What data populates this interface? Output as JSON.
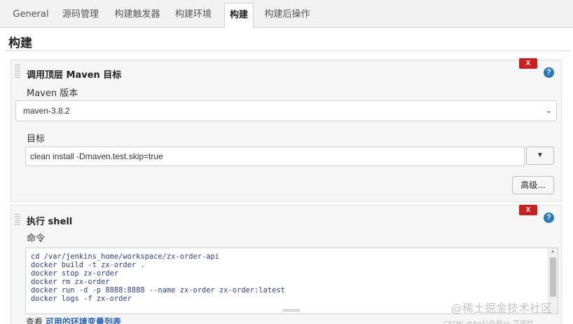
{
  "tabs": [
    {
      "label": "General"
    },
    {
      "label": "源码管理"
    },
    {
      "label": "构建触发器"
    },
    {
      "label": "构建环境"
    },
    {
      "label": "构建",
      "active": true
    },
    {
      "label": "构建后操作"
    }
  ],
  "section": {
    "title": "构建"
  },
  "maven_step": {
    "title": "调用顶层 Maven 目标",
    "delete_label": "X",
    "help_label": "?",
    "version_label": "Maven 版本",
    "version_value": "maven-3.8.2",
    "goals_label": "目标",
    "goals_value": "clean install -Dmaven.test.skip=true",
    "expand_label": "▼",
    "advanced_label": "高级..."
  },
  "shell_step": {
    "title": "执行 shell",
    "delete_label": "X",
    "help_label": "?",
    "command_label": "命令",
    "command_lines": [
      "cd /var/jenkins_home/workspace/zx-order-api",
      "docker build -t zx-order .",
      "docker stop zx-order",
      "docker rm zx-order",
      "docker run -d -p 8888:8888 --name zx-order zx-order:latest",
      "docker logs -f zx-order"
    ]
  },
  "footer": {
    "prefix": "查看",
    "link": "可用的环境变量列表"
  },
  "watermark": {
    "text": "@稀土掘金技术社区",
    "sub": "CSDN @Ao公众号zx 艾诺拉..."
  },
  "colors": {
    "delete_button": "#cc1f1f",
    "help_icon": "#2a7ab8",
    "link": "#2a63b8"
  }
}
